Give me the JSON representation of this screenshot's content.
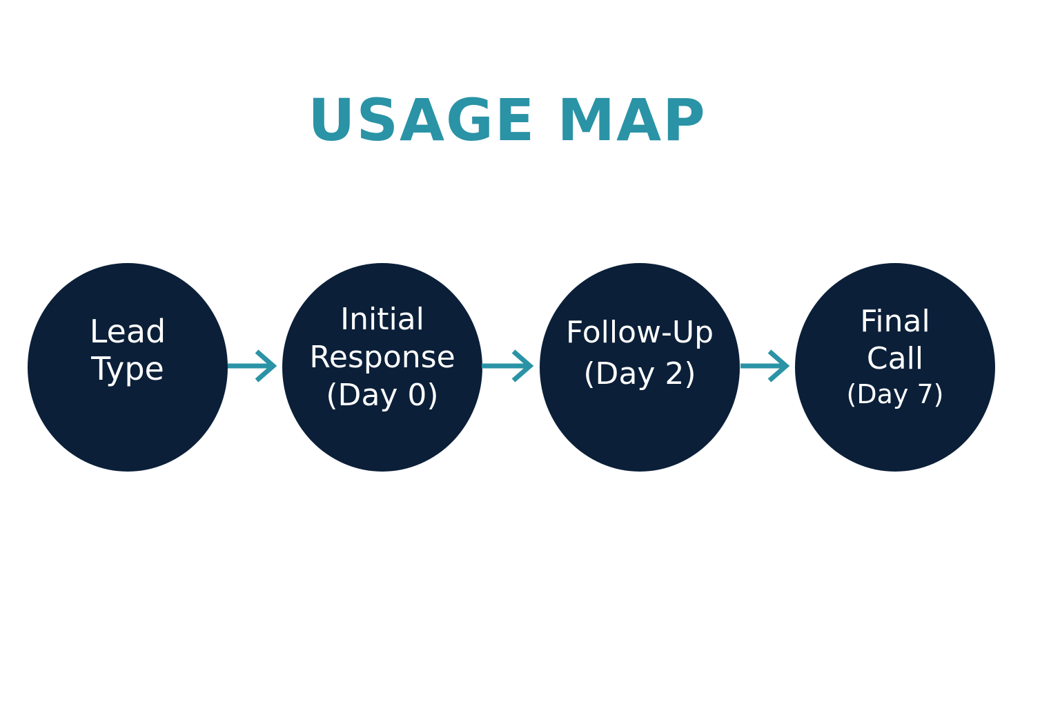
{
  "title": "USAGE MAP",
  "colors": {
    "accent": "#2a93a6",
    "node_fill": "#0b1f38",
    "node_text": "#ffffff",
    "background": "#ffffff"
  },
  "steps": [
    {
      "lines": [
        "Lead",
        "Type"
      ]
    },
    {
      "lines": [
        "Initial",
        "Response",
        "(Day 0)"
      ]
    },
    {
      "lines": [
        "Follow-Up",
        "(Day 2)"
      ]
    },
    {
      "lines": [
        "Final",
        "Call",
        "(Day 7)"
      ]
    }
  ],
  "connectors": [
    {
      "icon": "arrow-right-icon"
    },
    {
      "icon": "arrow-right-icon"
    },
    {
      "icon": "arrow-right-icon"
    }
  ]
}
